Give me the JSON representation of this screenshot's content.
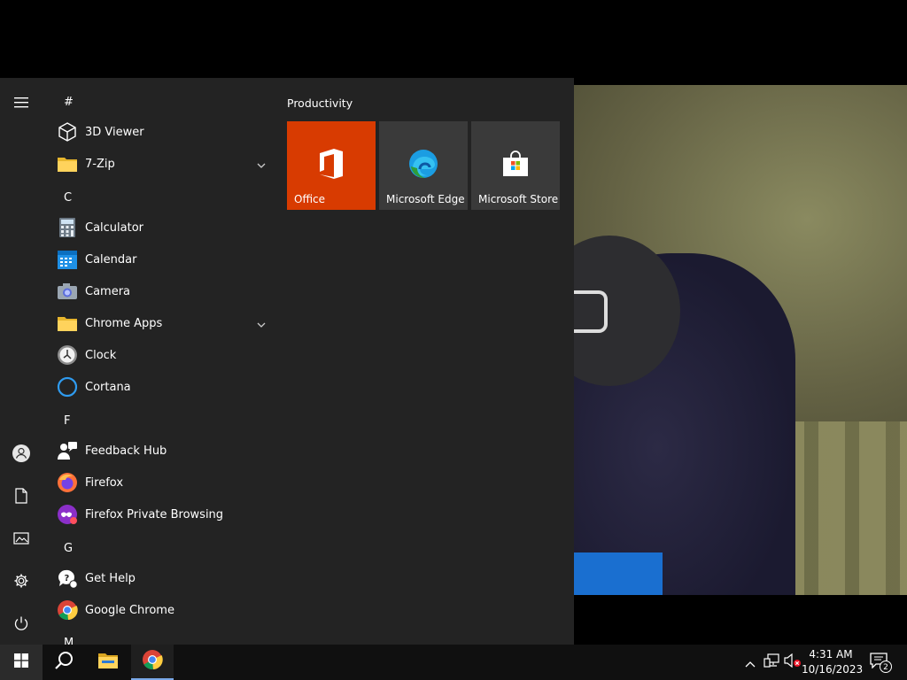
{
  "start_menu": {
    "app_list": [
      {
        "type": "letter",
        "text": "#"
      },
      {
        "type": "app",
        "label": "3D Viewer",
        "icon": "cube-icon"
      },
      {
        "type": "folder",
        "label": "7-Zip",
        "icon": "folder-icon",
        "expandable": true
      },
      {
        "type": "letter",
        "text": "C"
      },
      {
        "type": "app",
        "label": "Calculator",
        "icon": "calculator-icon"
      },
      {
        "type": "app",
        "label": "Calendar",
        "icon": "calendar-icon"
      },
      {
        "type": "app",
        "label": "Camera",
        "icon": "camera-icon"
      },
      {
        "type": "folder",
        "label": "Chrome Apps",
        "icon": "folder-icon",
        "expandable": true
      },
      {
        "type": "app",
        "label": "Clock",
        "icon": "clock-icon"
      },
      {
        "type": "app",
        "label": "Cortana",
        "icon": "cortana-icon"
      },
      {
        "type": "letter",
        "text": "F"
      },
      {
        "type": "app",
        "label": "Feedback Hub",
        "icon": "feedback-hub-icon"
      },
      {
        "type": "app",
        "label": "Firefox",
        "icon": "firefox-icon"
      },
      {
        "type": "app",
        "label": "Firefox Private Browsing",
        "icon": "firefox-private-icon"
      },
      {
        "type": "letter",
        "text": "G"
      },
      {
        "type": "app",
        "label": "Get Help",
        "icon": "get-help-icon"
      },
      {
        "type": "app",
        "label": "Google Chrome",
        "icon": "chrome-icon"
      },
      {
        "type": "letter",
        "text": "M"
      }
    ],
    "rail": [
      "hamburger-menu-icon",
      "user-icon",
      "documents-icon",
      "pictures-icon",
      "settings-gear-icon",
      "power-icon"
    ],
    "tile_group": {
      "title": "Productivity",
      "tiles": [
        {
          "label": "Office",
          "icon": "office-icon",
          "color": "#d83b01"
        },
        {
          "label": "Microsoft Edge",
          "icon": "edge-icon",
          "color": "#3a3a3a"
        },
        {
          "label": "Microsoft Store",
          "icon": "store-icon",
          "color": "#3a3a3a"
        }
      ]
    }
  },
  "taskbar": {
    "pinned": [
      "windows-start-icon",
      "search-icon",
      "file-explorer-icon",
      "chrome-icon"
    ],
    "tray": {
      "icons": [
        "chevron-up-icon",
        "network-icon",
        "volume-muted-icon"
      ],
      "time": "4:31 AM",
      "date": "10/16/2023",
      "notification_count": "2"
    }
  },
  "colors": {
    "accent": "#d83b01",
    "start_bg": "#232323",
    "taskbar_bg": "#101010"
  }
}
